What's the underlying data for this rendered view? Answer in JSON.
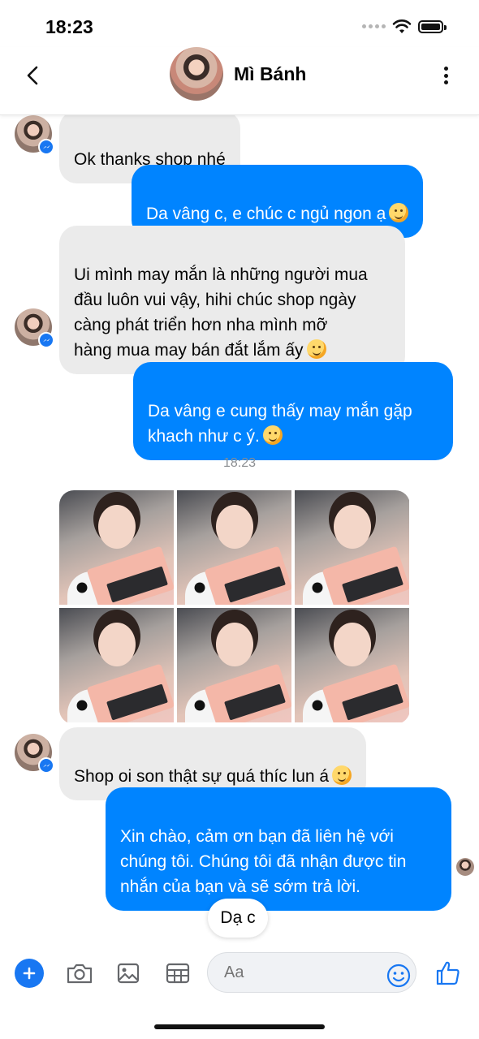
{
  "status_bar": {
    "time": "18:23"
  },
  "header": {
    "contact_name": "Mì Bánh"
  },
  "messages": [
    {
      "side": "in",
      "text": "Ok thanks shop nhé"
    },
    {
      "side": "out",
      "text": "Da vâng c, e chúc c ngủ ngon ạ"
    },
    {
      "side": "in",
      "text": "Ui mình may mắn là những người mua\nđầu luôn vui vậy, hihi chúc shop ngày\ncàng phát triển hơn nha mình mỡ\nhàng mua may bán đắt lắm ấy"
    },
    {
      "side": "out",
      "text": "Da vâng e cung thấy may mắn gặp\nkhach như c ý."
    },
    {
      "side": "in",
      "text": "Shop oi son thật sự quá thíc lun á"
    },
    {
      "side": "out",
      "text": "Xin chào, cảm ơn bạn đã liên hệ với\nchúng tôi. Chúng tôi đã nhận được tin\nnhắn của bạn và sẽ sớm trả lời."
    }
  ],
  "timestamp": "18:23",
  "photo_count": 6,
  "typing_pill": "Dạ c",
  "composer": {
    "placeholder": "Aa"
  },
  "colors": {
    "outgoing_bubble": "#0084ff",
    "incoming_bubble": "#ebebeb",
    "accent": "#1877f2"
  },
  "icons": [
    "back-icon",
    "more-icon",
    "plus-icon",
    "camera-icon",
    "gallery-icon",
    "sticker-icon",
    "emoji-icon",
    "like-icon",
    "messenger-icon"
  ]
}
